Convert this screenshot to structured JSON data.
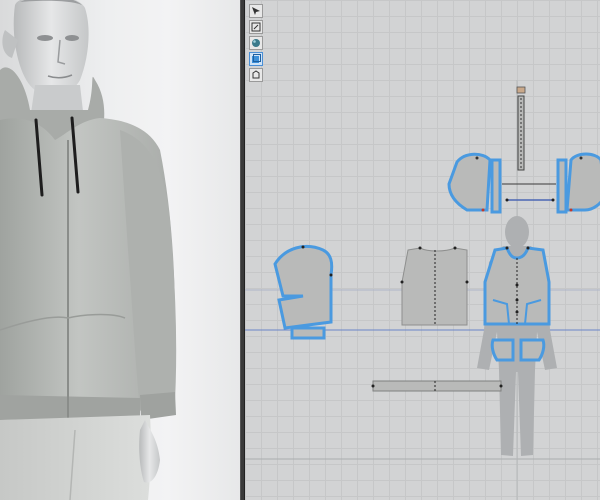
{
  "app": {
    "panels": [
      "3d-garment-view",
      "2d-pattern-view"
    ]
  },
  "toolbar_2d": {
    "tools": [
      {
        "icon": "select-move-icon",
        "active": false
      },
      {
        "icon": "transform-pattern-icon",
        "active": false
      },
      {
        "icon": "sphere-icon",
        "active": false
      },
      {
        "icon": "pattern-sheet-icon",
        "active": true
      },
      {
        "icon": "trace-icon",
        "active": false
      }
    ]
  },
  "colors": {
    "pattern_fill": "#b9bab9",
    "selected_outline": "#4a9ae0",
    "seam_line": "#5a6fa8",
    "avatar_silhouette": "#aeb0b2",
    "garment_3d": "#b4b7b4"
  },
  "patterns_2d": [
    {
      "name": "hood-left"
    },
    {
      "name": "hood-right"
    },
    {
      "name": "hood-strip"
    },
    {
      "name": "sleeve"
    },
    {
      "name": "back-body"
    },
    {
      "name": "front-body"
    },
    {
      "name": "front-pocket"
    },
    {
      "name": "waistband"
    },
    {
      "name": "zipper-tape"
    },
    {
      "name": "cuff"
    }
  ]
}
